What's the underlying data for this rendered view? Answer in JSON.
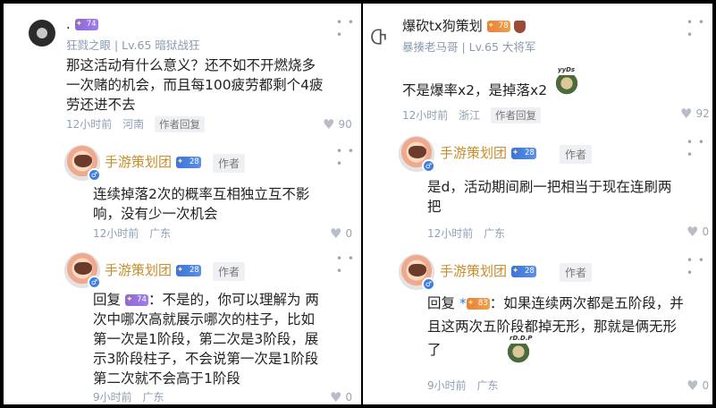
{
  "left": {
    "c1": {
      "name": ".",
      "level_badge": "74",
      "sub": "狂戮之眼 | Lv.65 暗狱战狂",
      "body": "那这活动有什么意义？还不如不开燃烧多一次赌的机会，而且每100疲劳都剩个4疲劳还进不去",
      "time": "12小时前",
      "location": "河南",
      "tag": "作者回复",
      "likes": "90"
    },
    "c2": {
      "name": "手游策划团",
      "badge": "28",
      "author_tag": "作者",
      "body": "连续掉落2次的概率互相独立互不影响，没有少一次机会",
      "time": "12小时前",
      "location": "广东",
      "likes": "0"
    },
    "c3": {
      "name": "手游策划团",
      "badge": "28",
      "author_tag": "作者",
      "reply_prefix": "回复",
      "reply_badge": "74",
      "body": "：不是的，你可以理解为 两次中哪次高就展示哪次的柱子，比如第一次是1阶段，第二次是3阶段，展示3阶段柱子，不会说第一次是1阶段第二次就不会高于1阶段",
      "time": "9小时前",
      "location": "广东",
      "likes": "0"
    }
  },
  "right": {
    "c1": {
      "name": "爆砍tx狗策划",
      "level_badge": "78",
      "sub": "暴揍老马哥 | Lv.65 大将军",
      "body": "不是爆率x2，是掉落x2",
      "sticker_caption": "yyDs",
      "time": "12小时前",
      "location": "浙江",
      "tag": "作者回复",
      "likes": "92"
    },
    "c2": {
      "name": "手游策划团",
      "badge": "28",
      "author_tag": "作者",
      "body": "是d，活动期间刷一把相当于现在连刷两把",
      "time": "12小时前",
      "location": "广东",
      "likes": "0"
    },
    "c3": {
      "name": "手游策划团",
      "badge": "28",
      "author_tag": "作者",
      "reply_prefix": "回复",
      "reply_user": "*",
      "reply_badge": "83",
      "body": "：如果连续两次都是五阶段，并且这两次五阶段都掉无形，那就是俩无形了",
      "sticker_caption": "rD.D.P",
      "time": "9小时前",
      "location": "广东",
      "likes": "0"
    }
  },
  "icons": {
    "more": "more-dots-icon",
    "like": "heart-icon"
  }
}
